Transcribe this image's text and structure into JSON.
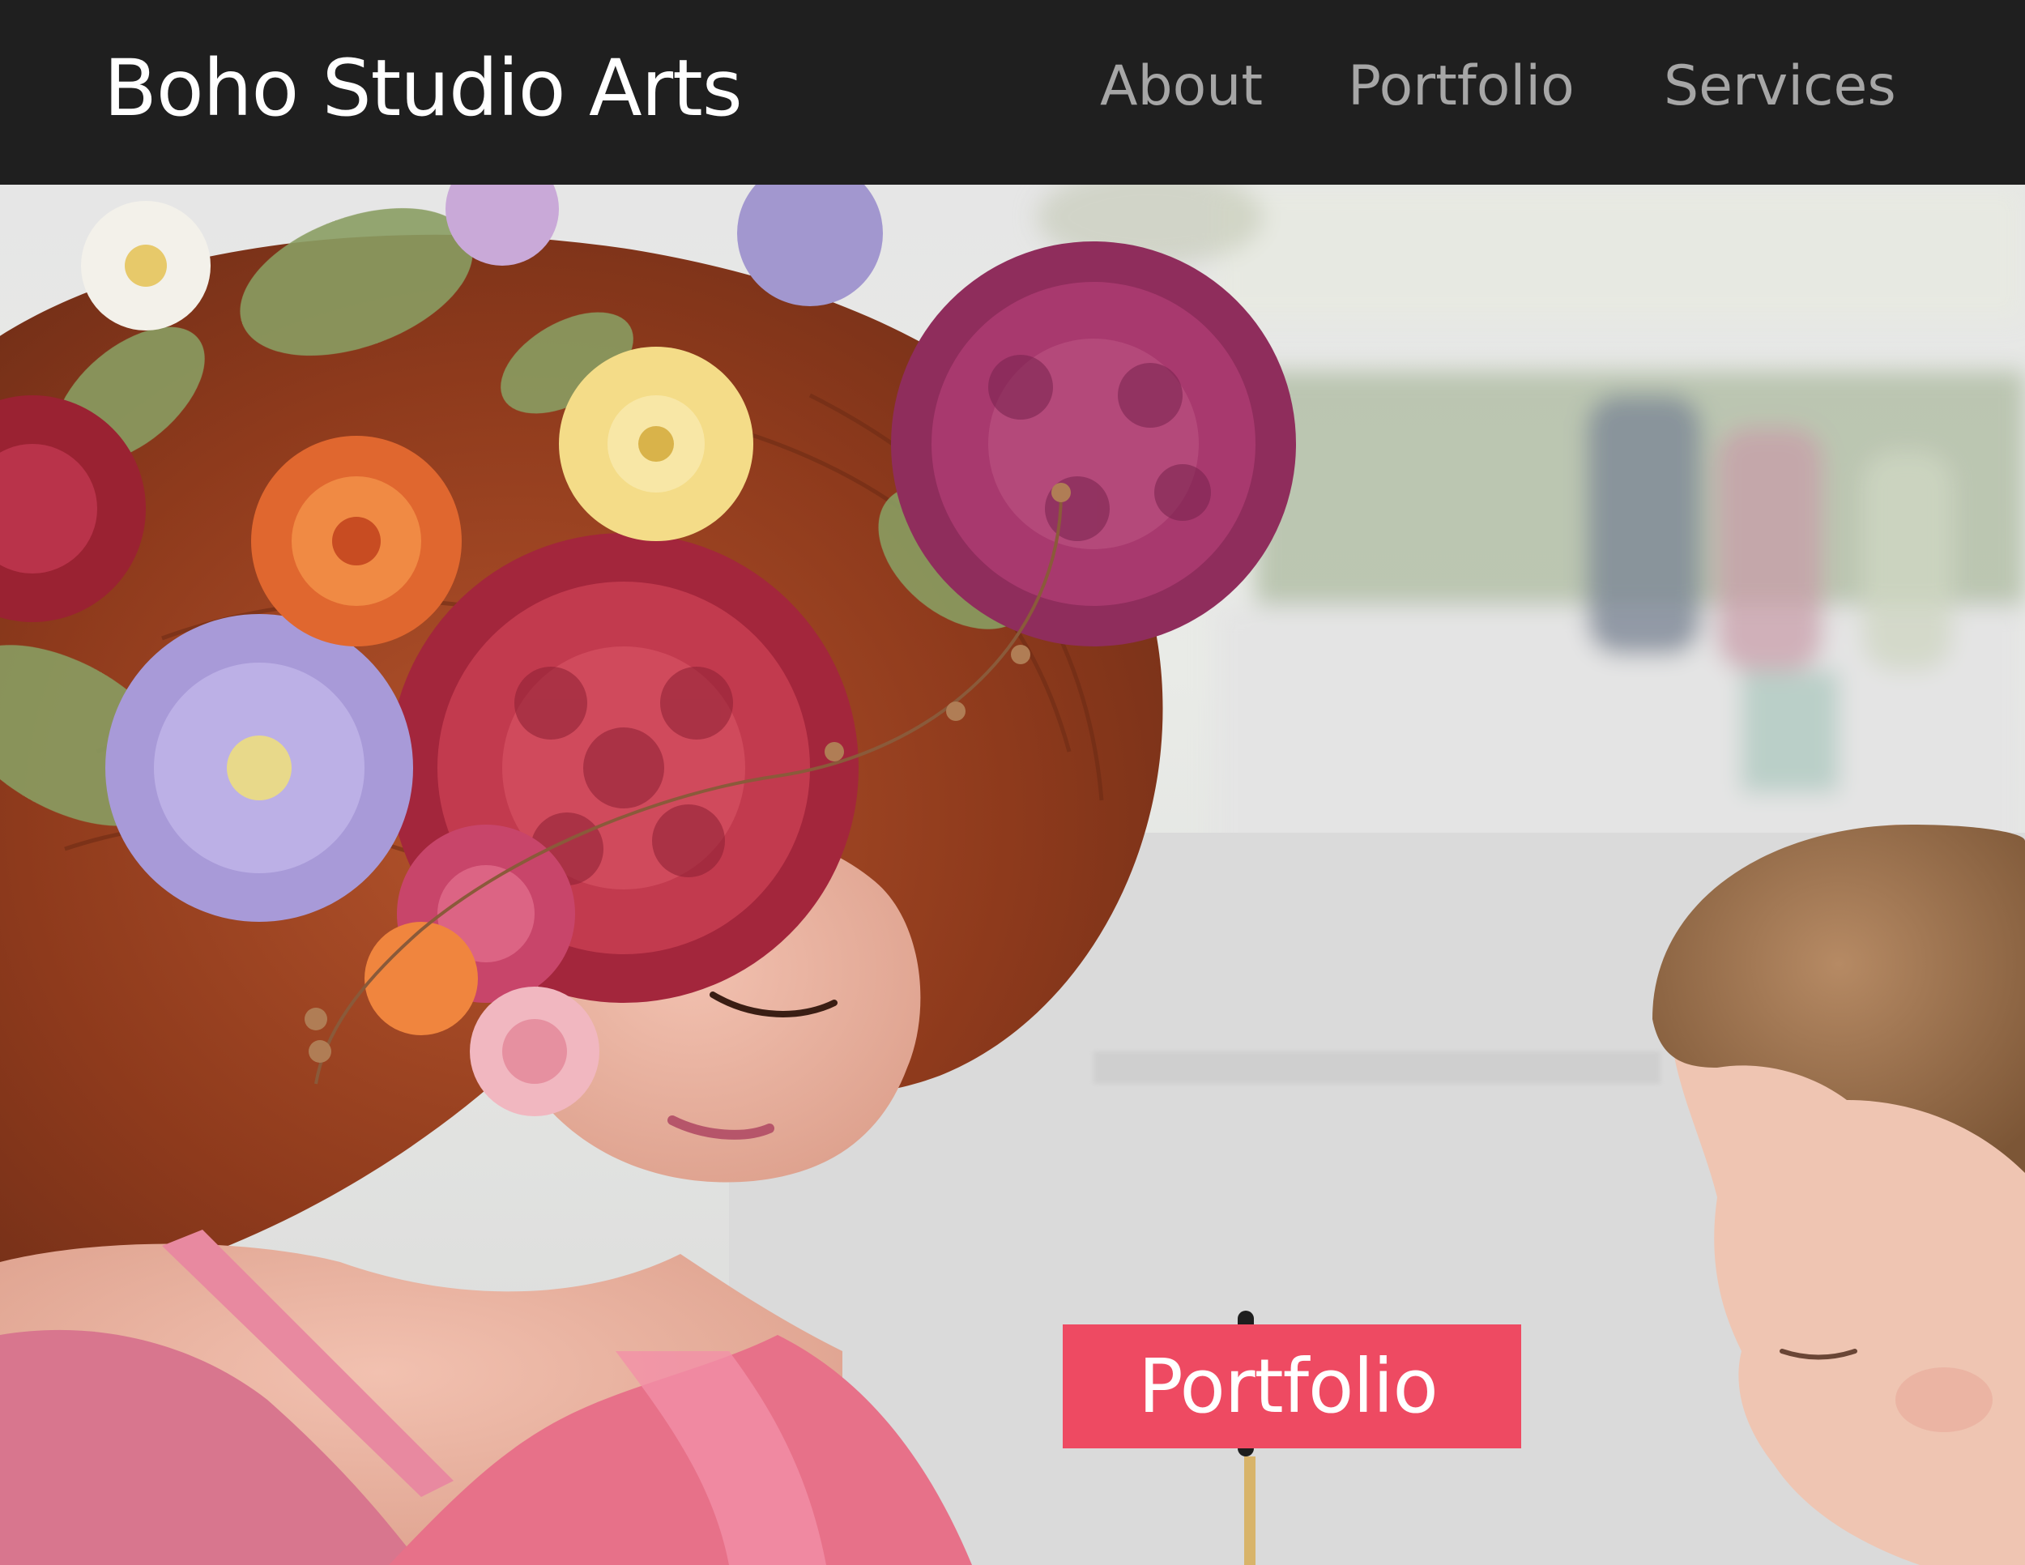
{
  "header": {
    "brand": "Boho Studio Arts",
    "nav": [
      {
        "label": "About"
      },
      {
        "label": "Portfolio"
      },
      {
        "label": "Services"
      }
    ]
  },
  "hero": {
    "cta_label": "Portfolio"
  },
  "colors": {
    "header_bg": "#1f1f1f",
    "brand_text": "#ffffff",
    "nav_text": "#a6a6a6",
    "cta_bg": "#ee4a62",
    "cta_text": "#ffffff"
  },
  "icons": []
}
